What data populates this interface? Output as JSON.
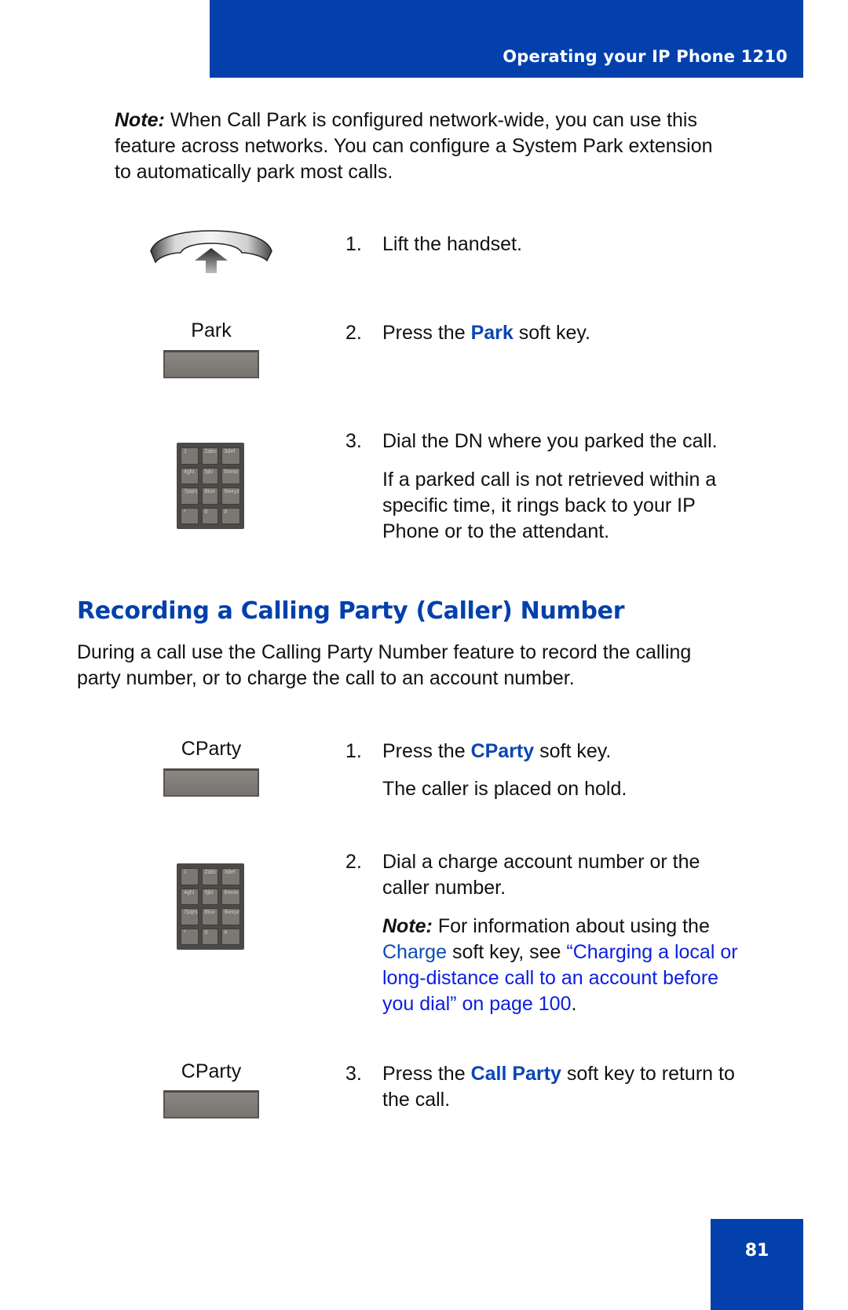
{
  "header": {
    "title": "Operating your IP Phone 1210"
  },
  "intro_note": {
    "lead": "Note:",
    "lines": [
      " When Call Park is configured network-wide, you can use this",
      "feature across networks. You can configure a System Park extension",
      "to automatically park most calls."
    ]
  },
  "park_steps": [
    {
      "num": "1.",
      "text": "Lift the handset.",
      "icon": "handset-lift-icon"
    },
    {
      "num": "2.",
      "pre": "Press the ",
      "key": "Park",
      "post": " soft key.",
      "softkey_label": "Park"
    },
    {
      "num": "3.",
      "text": "Dial the DN where you parked the call.",
      "detail": [
        "If a parked call is not retrieved within a",
        "specific time, it rings back to your IP",
        "Phone or to the attendant."
      ],
      "icon": "dialpad-icon"
    }
  ],
  "section": {
    "heading": "Recording a Calling Party (Caller) Number",
    "intro": [
      "During a call use the Calling Party Number feature to record the calling",
      "party number, or to charge the call to an account number."
    ]
  },
  "cparty_steps": [
    {
      "num": "1.",
      "pre": "Press the ",
      "key": "CParty",
      "post": " soft key.",
      "detail": "The caller is placed on hold.",
      "softkey_label": "CParty"
    },
    {
      "num": "2.",
      "lines": [
        "Dial a charge account number or the",
        "caller number."
      ],
      "note": {
        "lead": "Note:",
        "text1": " For information about using the",
        "charge": "Charge",
        "text2": " soft key, see ",
        "link_lines": [
          "“Charging a local or",
          "long-distance call to an account before",
          "you dial” on page 100"
        ],
        "end": "."
      },
      "icon": "dialpad-icon"
    },
    {
      "num": "3.",
      "pre": "Press the ",
      "key": "Call Party",
      "post": " soft key to return to",
      "line2": "the call.",
      "softkey_label": "CParty"
    }
  ],
  "keypad_keys": [
    "1",
    "2abc",
    "3def",
    "4ghi",
    "5jkl",
    "6mno",
    "7pqrs",
    "8tuv",
    "9wxyz",
    "*",
    "0",
    "#"
  ],
  "footer": {
    "page_number": "81"
  },
  "colors": {
    "brand_blue": "#0340ac",
    "link_blue": "#0a1ee0",
    "keyword_blue": "#0a46b4"
  }
}
